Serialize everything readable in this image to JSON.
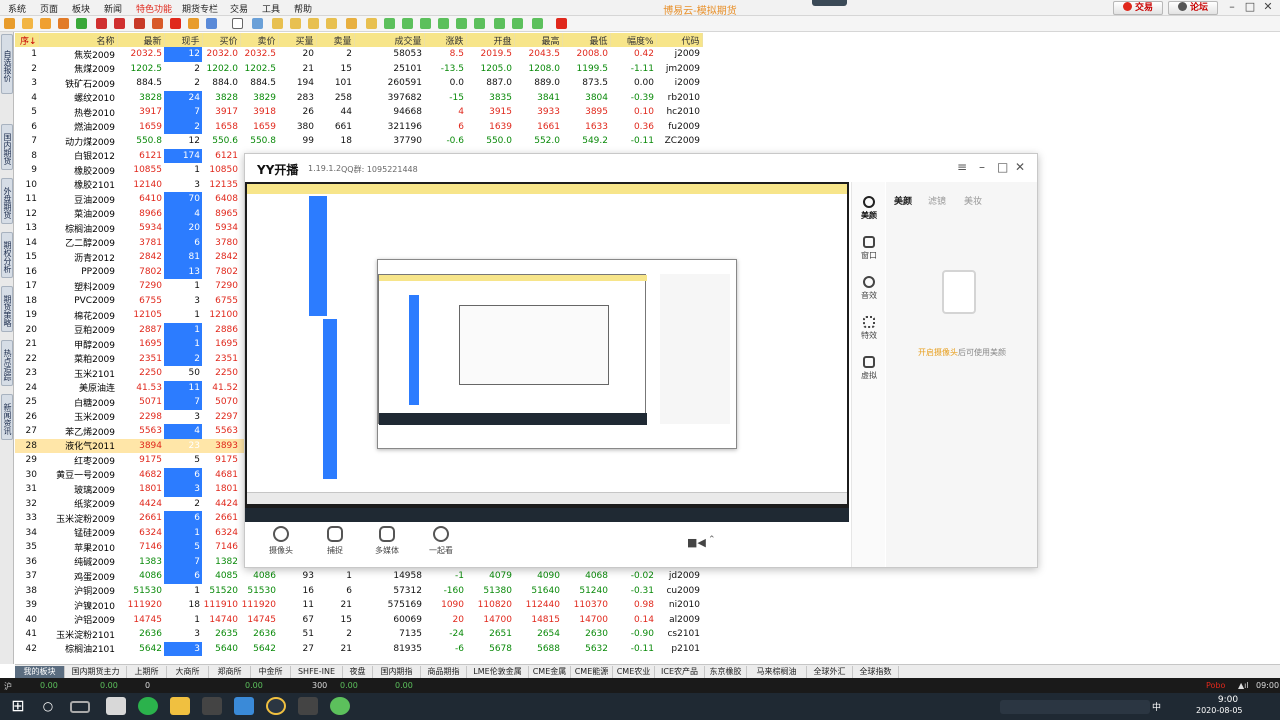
{
  "menubar": {
    "items": [
      "系统",
      "页面",
      "板块",
      "新闻",
      "特色功能",
      "期货专栏",
      "交易",
      "工具",
      "帮助"
    ],
    "active_item": "特色功能",
    "title": "博易云-模拟期货",
    "trade_btn": "交易",
    "forum_btn": "论坛"
  },
  "grid": {
    "headers": [
      "序↓",
      "名称",
      "最新",
      "现手",
      "买价",
      "卖价",
      "买量",
      "卖量",
      "成交量",
      "涨跌",
      "开盘",
      "最高",
      "最低",
      "幅度%",
      "代码"
    ],
    "rows": [
      [
        "1",
        "焦炭2009",
        "2032.5",
        "12",
        "2032.0",
        "2032.5",
        "20",
        "2",
        "58053",
        "8.5",
        "2019.5",
        "2043.5",
        "2008.0",
        "0.42",
        "j2009"
      ],
      [
        "2",
        "焦煤2009",
        "1202.5",
        "2",
        "1202.0",
        "1202.5",
        "21",
        "15",
        "25101",
        "-13.5",
        "1205.0",
        "1208.0",
        "1199.5",
        "-1.11",
        "jm2009"
      ],
      [
        "3",
        "铁矿石2009",
        "884.5",
        "2",
        "884.0",
        "884.5",
        "194",
        "101",
        "260591",
        "0.0",
        "887.0",
        "889.0",
        "873.5",
        "0.00",
        "i2009"
      ],
      [
        "4",
        "螺纹2010",
        "3828",
        "24",
        "3828",
        "3829",
        "283",
        "258",
        "397682",
        "-15",
        "3835",
        "3841",
        "3804",
        "-0.39",
        "rb2010"
      ],
      [
        "5",
        "热卷2010",
        "3917",
        "7",
        "3917",
        "3918",
        "26",
        "44",
        "94668",
        "4",
        "3915",
        "3933",
        "3895",
        "0.10",
        "hc2010"
      ],
      [
        "6",
        "燃油2009",
        "1659",
        "2",
        "1658",
        "1659",
        "380",
        "661",
        "321196",
        "6",
        "1639",
        "1661",
        "1633",
        "0.36",
        "fu2009"
      ],
      [
        "7",
        "动力煤2009",
        "550.8",
        "12",
        "550.6",
        "550.8",
        "99",
        "18",
        "37790",
        "-0.6",
        "550.0",
        "552.0",
        "549.2",
        "-0.11",
        "ZC2009"
      ],
      [
        "8",
        "白银2012",
        "6121",
        "174",
        "6121",
        "",
        "",
        "",
        "",
        "",
        "",
        "",
        "",
        "",
        ""
      ],
      [
        "9",
        "橡胶2009",
        "10855",
        "1",
        "10850",
        "",
        "",
        "",
        "",
        "",
        "",
        "",
        "",
        "",
        ""
      ],
      [
        "10",
        "橡胶2101",
        "12140",
        "3",
        "12135",
        "",
        "",
        "",
        "",
        "",
        "",
        "",
        "",
        "",
        ""
      ],
      [
        "11",
        "豆油2009",
        "6410",
        "70",
        "6408",
        "",
        "",
        "",
        "",
        "",
        "",
        "",
        "",
        "",
        ""
      ],
      [
        "12",
        "菜油2009",
        "8966",
        "4",
        "8965",
        "",
        "",
        "",
        "",
        "",
        "",
        "",
        "",
        "",
        ""
      ],
      [
        "13",
        "棕榈油2009",
        "5934",
        "20",
        "5934",
        "",
        "",
        "",
        "",
        "",
        "",
        "",
        "",
        "",
        ""
      ],
      [
        "14",
        "乙二醇2009",
        "3781",
        "6",
        "3780",
        "",
        "",
        "",
        "",
        "",
        "",
        "",
        "",
        "",
        ""
      ],
      [
        "15",
        "沥青2012",
        "2842",
        "81",
        "2842",
        "",
        "",
        "",
        "",
        "",
        "",
        "",
        "",
        "",
        ""
      ],
      [
        "16",
        "PP2009",
        "7802",
        "13",
        "7802",
        "",
        "",
        "",
        "",
        "",
        "",
        "",
        "",
        "",
        ""
      ],
      [
        "17",
        "塑料2009",
        "7290",
        "1",
        "7290",
        "",
        "",
        "",
        "",
        "",
        "",
        "",
        "",
        "",
        ""
      ],
      [
        "18",
        "PVC2009",
        "6755",
        "3",
        "6755",
        "",
        "",
        "",
        "",
        "",
        "",
        "",
        "",
        "",
        ""
      ],
      [
        "19",
        "棉花2009",
        "12105",
        "1",
        "12100",
        "",
        "",
        "",
        "",
        "",
        "",
        "",
        "",
        "",
        ""
      ],
      [
        "20",
        "豆粕2009",
        "2887",
        "1",
        "2886",
        "",
        "",
        "",
        "",
        "",
        "",
        "",
        "",
        "",
        ""
      ],
      [
        "21",
        "甲醇2009",
        "1695",
        "1",
        "1695",
        "",
        "",
        "",
        "",
        "",
        "",
        "",
        "",
        "",
        ""
      ],
      [
        "22",
        "菜粕2009",
        "2351",
        "2",
        "2351",
        "",
        "",
        "",
        "",
        "",
        "",
        "",
        "",
        "",
        ""
      ],
      [
        "23",
        "玉米2101",
        "2250",
        "50",
        "2250",
        "",
        "",
        "",
        "",
        "",
        "",
        "",
        "",
        "",
        ""
      ],
      [
        "24",
        "美原油连",
        "41.53",
        "11",
        "41.52",
        "",
        "",
        "",
        "",
        "",
        "",
        "",
        "",
        "",
        ""
      ],
      [
        "25",
        "白糖2009",
        "5071",
        "7",
        "5070",
        "",
        "",
        "",
        "",
        "",
        "",
        "",
        "",
        "",
        ""
      ],
      [
        "26",
        "玉米2009",
        "2298",
        "3",
        "2297",
        "",
        "",
        "",
        "",
        "",
        "",
        "",
        "",
        "",
        ""
      ],
      [
        "27",
        "苯乙烯2009",
        "5563",
        "4",
        "5563",
        "",
        "",
        "",
        "",
        "",
        "",
        "",
        "",
        "",
        ""
      ],
      [
        "28",
        "液化气2011",
        "3894",
        "23",
        "3893",
        "",
        "",
        "",
        "",
        "",
        "",
        "",
        "",
        "",
        ""
      ],
      [
        "29",
        "红枣2009",
        "9175",
        "5",
        "9175",
        "",
        "",
        "",
        "",
        "",
        "",
        "",
        "",
        "",
        ""
      ],
      [
        "30",
        "黄豆一号2009",
        "4682",
        "6",
        "4681",
        "",
        "",
        "",
        "",
        "",
        "",
        "",
        "",
        "",
        ""
      ],
      [
        "31",
        "玻璃2009",
        "1801",
        "3",
        "1801",
        "",
        "",
        "",
        "",
        "",
        "",
        "",
        "",
        "",
        ""
      ],
      [
        "32",
        "纸浆2009",
        "4424",
        "2",
        "4424",
        "",
        "",
        "",
        "",
        "",
        "",
        "",
        "",
        "",
        ""
      ],
      [
        "33",
        "玉米淀粉2009",
        "2661",
        "6",
        "2661",
        "",
        "",
        "",
        "",
        "",
        "",
        "",
        "",
        "",
        ""
      ],
      [
        "34",
        "锰硅2009",
        "6324",
        "1",
        "6324",
        "",
        "",
        "",
        "",
        "",
        "",
        "",
        "",
        "",
        ""
      ],
      [
        "35",
        "苹果2010",
        "7146",
        "5",
        "7146",
        "",
        "",
        "",
        "",
        "",
        "",
        "",
        "",
        "",
        ""
      ],
      [
        "36",
        "纯碱2009",
        "1383",
        "7",
        "1382",
        "1383",
        "99",
        "97",
        "374018",
        "-18",
        "1464",
        "1466",
        "1381",
        "-1.28",
        "SA2009"
      ],
      [
        "37",
        "鸡蛋2009",
        "4086",
        "6",
        "4085",
        "4086",
        "93",
        "1",
        "14958",
        "-1",
        "4079",
        "4090",
        "4068",
        "-0.02",
        "jd2009"
      ],
      [
        "38",
        "沪铜2009",
        "51530",
        "1",
        "51520",
        "51530",
        "16",
        "6",
        "57312",
        "-160",
        "51380",
        "51640",
        "51240",
        "-0.31",
        "cu2009"
      ],
      [
        "39",
        "沪镍2010",
        "111920",
        "18",
        "111910",
        "111920",
        "11",
        "21",
        "575169",
        "1090",
        "110820",
        "112440",
        "110370",
        "0.98",
        "ni2010"
      ],
      [
        "40",
        "沪铝2009",
        "14745",
        "1",
        "14740",
        "14745",
        "67",
        "15",
        "60069",
        "20",
        "14700",
        "14815",
        "14700",
        "0.14",
        "al2009"
      ],
      [
        "41",
        "玉米淀粉2101",
        "2636",
        "3",
        "2635",
        "2636",
        "51",
        "2",
        "7135",
        "-24",
        "2651",
        "2654",
        "2630",
        "-0.90",
        "cs2101"
      ],
      [
        "42",
        "棕榈油2101",
        "5642",
        "3",
        "5640",
        "5642",
        "27",
        "21",
        "81935",
        "-6",
        "5678",
        "5688",
        "5632",
        "-0.11",
        "p2101"
      ]
    ]
  },
  "bottom_tabs": [
    "我的板块",
    "国内期货主力",
    "上期所",
    "大商所",
    "郑商所",
    "中金所",
    "SHFE-INE",
    "夜盘",
    "国内期指",
    "商品期指",
    "LME伦敦金属",
    "CME金属",
    "CME能源",
    "CME农业",
    "ICE农产品",
    "东京橡胶",
    "马来棕榈油",
    "全球外汇",
    "全球指数"
  ],
  "left_tabs": [
    "自选报价",
    "国内期货",
    "外盘期货",
    "期权分析",
    "期货策略",
    "热点追踪",
    "新闻资讯"
  ],
  "status": {
    "a": "0.00",
    "b": "0.00",
    "c": "0",
    "d": "0.00",
    "e": "300",
    "f": "0.00",
    "g": "0.00",
    "brand": "Pobo",
    "clock": "09:00"
  },
  "taskbar": {
    "time": "9:00",
    "date": "2020-08-05",
    "ime": "中"
  },
  "yy": {
    "logo": "YY开播",
    "version": "1.19.1.2",
    "qq": "QQ群: 1095221448",
    "bottom_buttons": [
      "摄像头",
      "捕捉",
      "多媒体",
      "一起看"
    ],
    "side_items": [
      "美颜",
      "窗口",
      "音效",
      "特效",
      "虚拟"
    ],
    "panel_tabs": [
      "美颜",
      "滤镜",
      "美妆"
    ],
    "hint_link": "开启摄像头",
    "hint_text": "后可使用美颜"
  },
  "colors": {
    "up": "#e0281c",
    "down": "#0a8a0a",
    "blue": "#2c7cff",
    "header": "#f7e58a",
    "selected": "#ffe6a8"
  }
}
